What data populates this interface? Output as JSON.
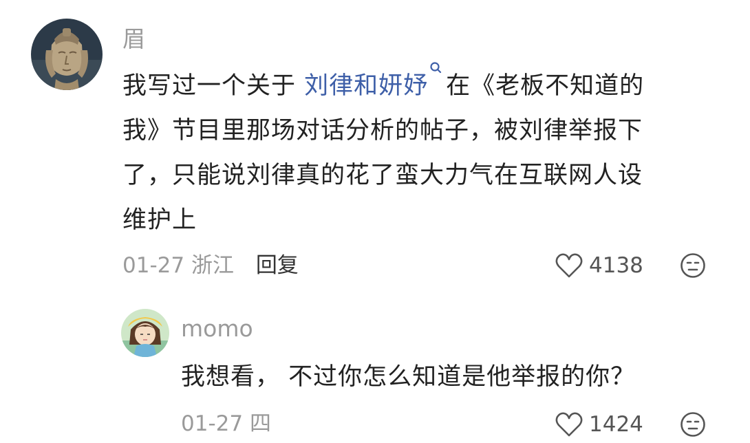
{
  "comment": {
    "username": "眉",
    "text_before_mention": "我写过一个关于 ",
    "mention": "刘律和妍妤",
    "text_line1_after": "在《老板不知道的",
    "text_line2": "我》节目里那场对话分析的帖子，被刘律举报下",
    "text_line3": "了，只能说刘律真的花了蛮大力气在互联网人设",
    "text_line4": "维护上",
    "date": "01-27",
    "location": "浙江",
    "reply_label": "回复",
    "likes": "4138",
    "icons": [
      "statue-avatar",
      "search-icon",
      "heart-outline-icon",
      "neutral-face-icon"
    ]
  },
  "reply": {
    "username": "momo",
    "text": "我想看， 不过你怎么知道是他举报的你？",
    "date": "01-27",
    "location_partial": "四",
    "likes": "1424",
    "icons": [
      "cartoon-girl-avatar",
      "heart-outline-icon",
      "neutral-face-icon"
    ]
  },
  "colors": {
    "mention": "#3e5fa8",
    "text": "#222222",
    "meta": "#9a9a9a"
  }
}
